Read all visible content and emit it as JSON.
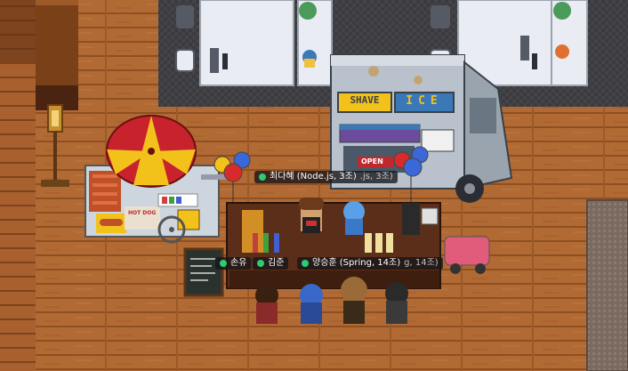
{
  "colors": {
    "floor_wood": "#b26a34",
    "floor_wood_dark": "#8e4f22",
    "carpet": "#3b3b3f",
    "desk": "#e9ecf2",
    "online": "#2ecc71",
    "umbrella_red": "#c8222c",
    "umbrella_yellow": "#f2c21b",
    "truck_body": "#b9c2cc",
    "counter": "#5a2e18"
  },
  "truck": {
    "sign_left": "SHAVE",
    "sign_right": "ICE",
    "open_sign": "OPEN"
  },
  "cart": {
    "sign": "HOT DOG"
  },
  "players": [
    {
      "name": "최다혜 (Node.js, 3조)",
      "trailing": ".js, 3조)",
      "status_color": "#2ecc71"
    },
    {
      "name": "손유",
      "status_color": "#2ecc71"
    },
    {
      "name": "김준",
      "status_color": "#2ecc71"
    },
    {
      "name": "양승훈 (Spring, 14조)",
      "trailing": "g, 14조)",
      "status_color": "#2ecc71"
    }
  ]
}
